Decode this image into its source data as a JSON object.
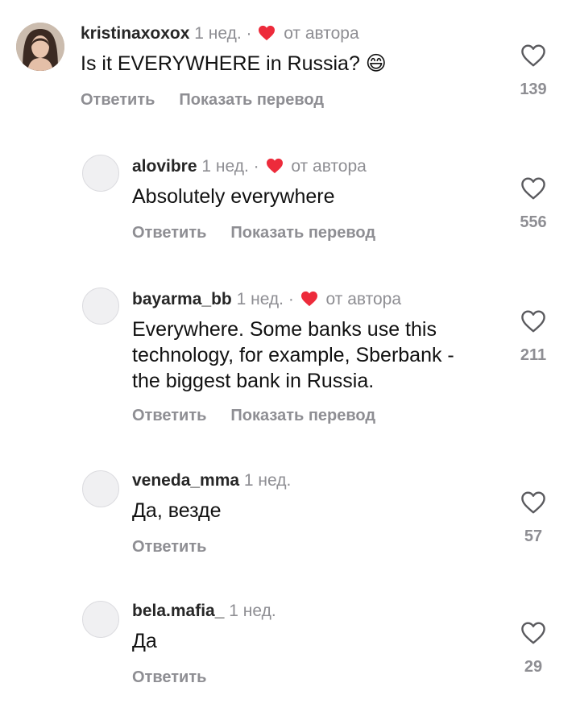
{
  "colors": {
    "heart": "#ed2b3b",
    "muted": "#8e8e93",
    "text": "#111111"
  },
  "comments": [
    {
      "username": "kristinaxoxox",
      "time": "1 нед.",
      "separator": "·",
      "author_like": "от автора",
      "text": "Is it EVERYWHERE in Russia? 😄",
      "reply": "Ответить",
      "translate": "Показать перевод",
      "likes": "139"
    },
    {
      "username": "alovibre",
      "time": "1 нед.",
      "separator": "·",
      "author_like": "от автора",
      "text": "Absolutely everywhere",
      "reply": "Ответить",
      "translate": "Показать перевод",
      "likes": "556"
    },
    {
      "username": "bayarma_bb",
      "time": "1 нед.",
      "separator": "·",
      "author_like": "от автора",
      "text": "Everywhere. Some banks use this technology, for example, Sberbank - the biggest bank in Russia.",
      "reply": "Ответить",
      "translate": "Показать перевод",
      "likes": "211"
    },
    {
      "username": "veneda_mma",
      "time": "1 нед.",
      "text": "Да, везде",
      "reply": "Ответить",
      "likes": "57"
    },
    {
      "username": "bela.mafia_",
      "time": "1 нед.",
      "text": "Да",
      "reply": "Ответить",
      "likes": "29"
    }
  ]
}
